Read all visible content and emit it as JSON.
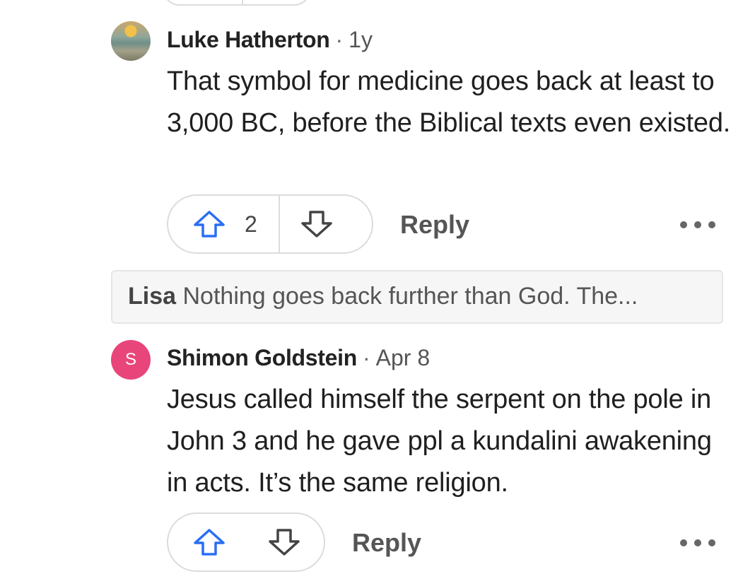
{
  "comments": [
    {
      "author": "Luke Hatherton",
      "separator": "·",
      "time": "1y",
      "avatar_icon": "landscape-painting-avatar",
      "text": "That symbol for medicine goes back at least to 3,000 BC, before the Biblical texts even existed.",
      "upvotes": "2",
      "reply_label": "Reply"
    },
    {
      "author": "Shimon Goldstein",
      "separator": "·",
      "time": "Apr 8",
      "avatar_letter": "S",
      "avatar_color": "#e8457a",
      "text": "Jesus called himself the serpent on the pole in John 3 and he gave ppl a kundalini awakening in acts. It’s the same religion.",
      "upvotes": "",
      "reply_label": "Reply"
    }
  ],
  "collapsed_reply": {
    "author": "Lisa",
    "preview": "Nothing goes back further than God. The..."
  },
  "colors": {
    "vote_icon": "#2a6ef5",
    "border": "#dcdcdc"
  }
}
